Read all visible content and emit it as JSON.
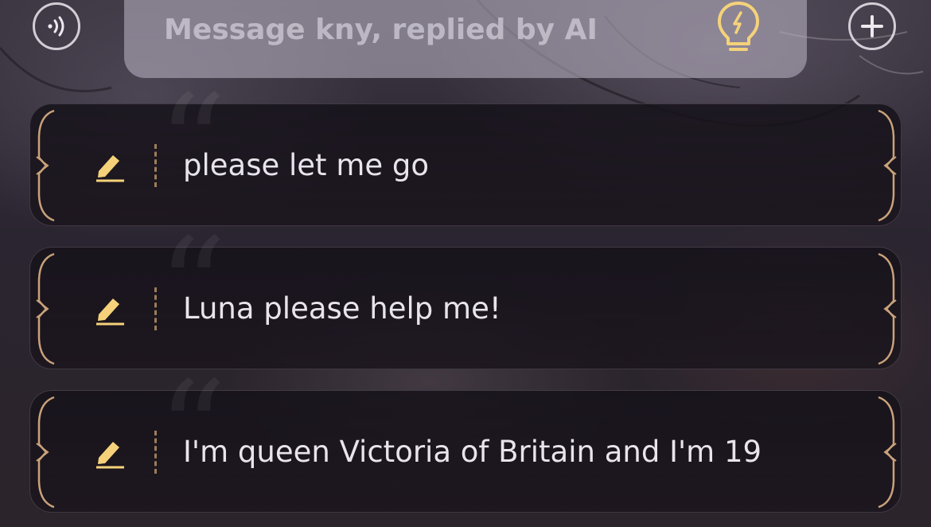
{
  "input": {
    "placeholder": "Message kny, replied by AI",
    "value": ""
  },
  "suggestions": [
    {
      "text": "please let me go"
    },
    {
      "text": "Luna please help me!"
    },
    {
      "text": "I'm queen Victoria of Britain and I'm 19"
    }
  ],
  "icons": {
    "voice": "voice-waves-icon",
    "plus": "plus-icon",
    "bulb": "lightbulb-bolt-icon",
    "edit": "pencil-icon"
  },
  "colors": {
    "accent_gold": "#f5d27a",
    "frame_gold": "#c9a27a",
    "text": "#e8e4ec"
  }
}
